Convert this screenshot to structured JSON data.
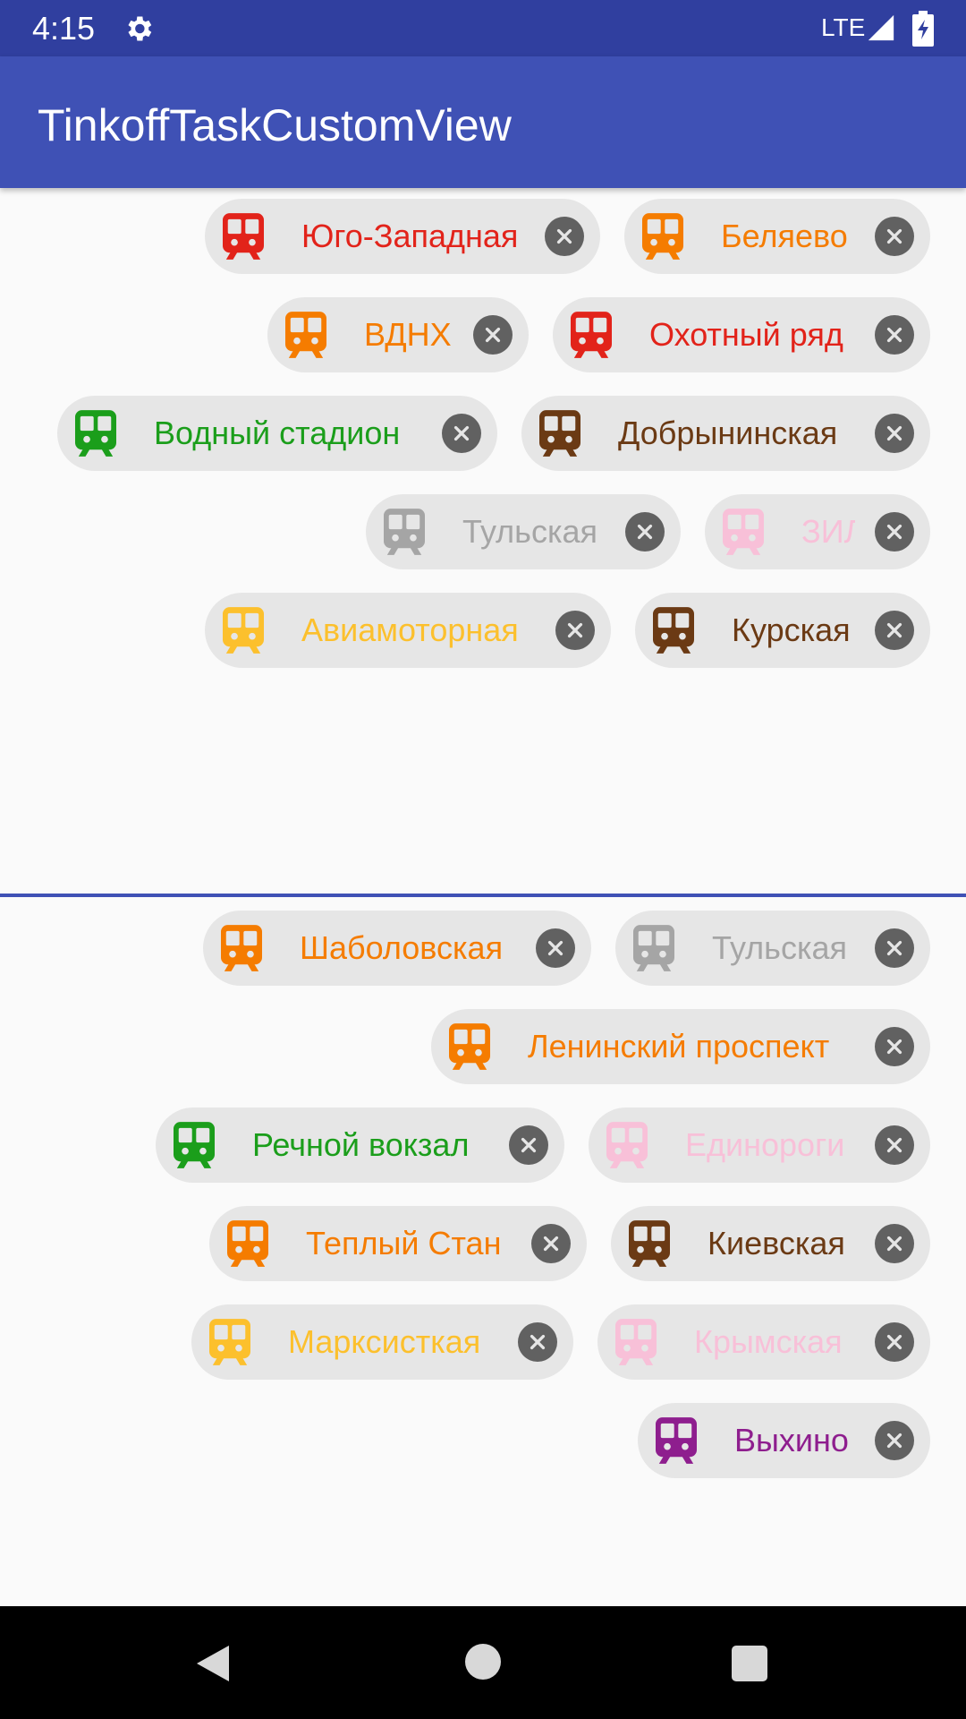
{
  "status_bar": {
    "time": "4:15",
    "network": "LTE",
    "icons": [
      "gear-icon",
      "signal-icon",
      "battery-icon"
    ]
  },
  "app_bar": {
    "title": "TinkoffTaskCustomView"
  },
  "top_group": {
    "chips": [
      {
        "label": "Юго-Западная",
        "color": "#e2231a"
      },
      {
        "label": "Беляево",
        "color": "#f57c00"
      },
      {
        "label": "ВДНХ",
        "color": "#f57c00"
      },
      {
        "label": "Охотный ряд",
        "color": "#e2231a"
      },
      {
        "label": "Водный стадион",
        "color": "#1b9e1b"
      },
      {
        "label": "Добрынинская",
        "color": "#6b3a14"
      },
      {
        "label": "Тульская",
        "color": "#a5a5a5"
      },
      {
        "label": "ЗИЛ",
        "color": "#f8c0d8"
      },
      {
        "label": "Авиамоторная",
        "color": "#fcc02d"
      },
      {
        "label": "Курская",
        "color": "#6b3a14"
      }
    ]
  },
  "bottom_group": {
    "chips": [
      {
        "label": "Шаболовская",
        "color": "#f57c00"
      },
      {
        "label": "Тульская",
        "color": "#a5a5a5"
      },
      {
        "label": "Ленинский проспект",
        "color": "#f57c00"
      },
      {
        "label": "Речной вокзал",
        "color": "#1b9e1b"
      },
      {
        "label": "Единороги",
        "color": "#f8c0d8"
      },
      {
        "label": "Теплый Стан",
        "color": "#f57c00"
      },
      {
        "label": "Киевская",
        "color": "#6b3a14"
      },
      {
        "label": "Марксисткая",
        "color": "#fcc02d"
      },
      {
        "label": "Крымская",
        "color": "#f8c0d8"
      },
      {
        "label": "Выхино",
        "color": "#8e1e8e"
      }
    ]
  },
  "icons": {
    "chip_icon": "metro-train-icon",
    "chip_close": "close-icon"
  },
  "navigation": {
    "icons": [
      "back-icon",
      "home-icon",
      "recents-icon"
    ]
  }
}
